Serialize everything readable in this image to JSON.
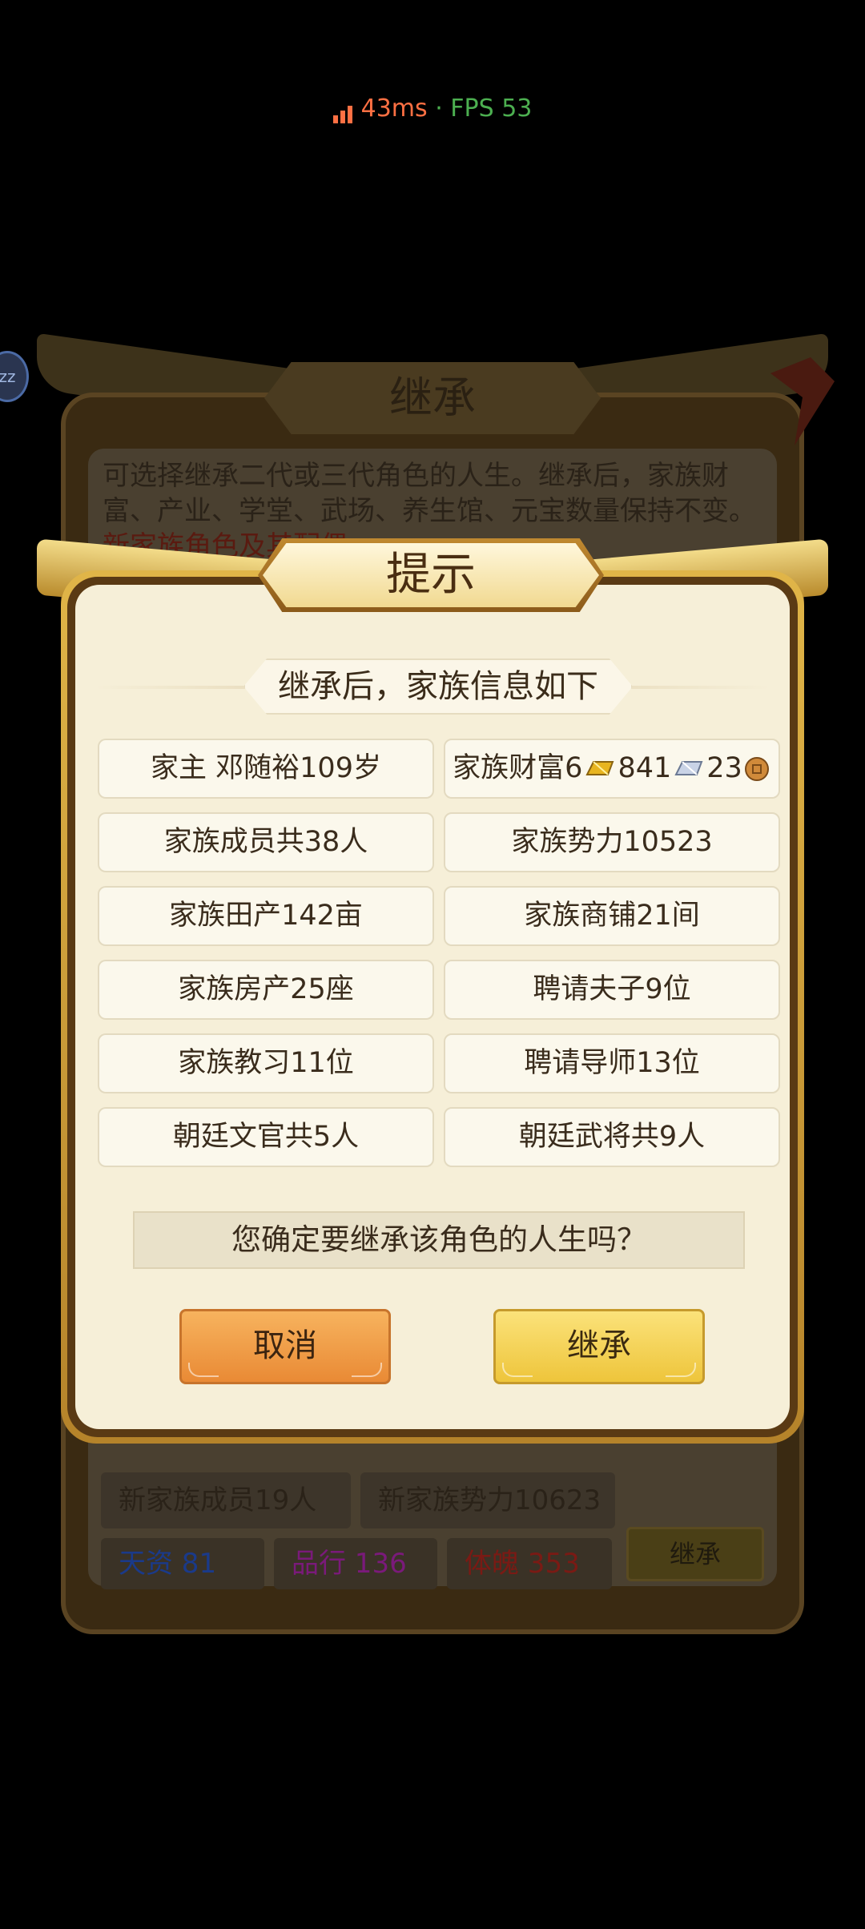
{
  "status": {
    "ping": "43ms",
    "separator": "·",
    "fps": "FPS 53"
  },
  "background": {
    "title": "继承",
    "description": "可选择继承二代或三代角色的人生。继承后，家族财富、产业、学堂、武场、养生馆、元宝数量保持不变。",
    "description_red": "新家族",
    "description_red_tail": "角色及其配偶",
    "members": "新家族成员19人",
    "power": "新家族势力10623",
    "talent": "天资 81",
    "conduct": "品行 136",
    "physique": "体魄 353",
    "button": "继承",
    "colors": {
      "talent": "#1a3a8a",
      "conduct": "#7a1a7a",
      "physique": "#7a1a14"
    }
  },
  "dialog": {
    "title": "提示",
    "subtitle": "继承后，家族信息如下",
    "items": [
      "家主 邓随裕109岁",
      {
        "prefix": "家族财富6",
        "gold_icon": "gold-ingot-icon",
        "mid": "841",
        "silver_icon": "silver-ingot-icon",
        "tail": "23",
        "coin_icon": "copper-coin-icon"
      },
      "家族成员共38人",
      "家族势力10523",
      "家族田产142亩",
      "家族商铺21间",
      "家族房产25座",
      "聘请夫子9位",
      "家族教习11位",
      "聘请导师13位",
      "朝廷文官共5人",
      "朝廷武将共9人"
    ],
    "confirm_text": "您确定要继承该角色的人生吗？",
    "cancel_label": "取消",
    "inherit_label": "继承"
  }
}
